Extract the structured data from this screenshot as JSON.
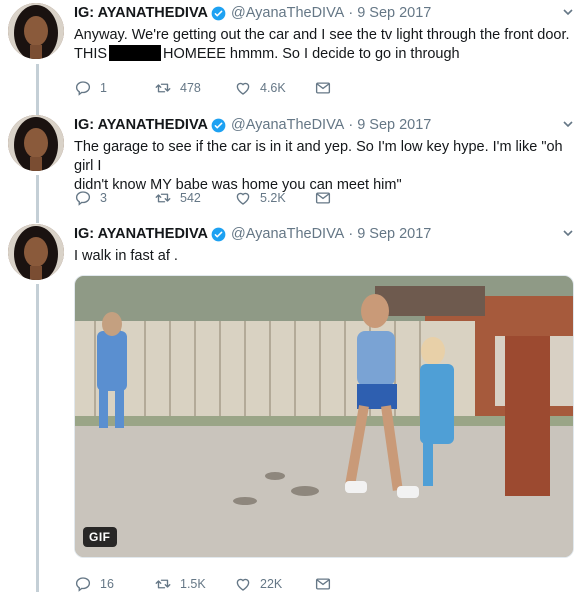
{
  "tweets": [
    {
      "name": "IG: AYANATHEDIVA",
      "handle": "@AyanaTheDIVA",
      "separator": "·",
      "date": "9 Sep 2017",
      "text_line1": "Anyway. We're getting out the car and I see the tv light through the front door.",
      "text_line2_before": "THIS",
      "text_line2_after": "HOMEEE hmmm. So I decide to go in through",
      "replies": "1",
      "retweets": "478",
      "likes": "4.6K"
    },
    {
      "name": "IG: AYANATHEDIVA",
      "handle": "@AyanaTheDIVA",
      "separator": "·",
      "date": "9 Sep 2017",
      "text_line1": "The garage to see if the car is in it and yep. So I'm low key hype. I'm like \"oh girl I",
      "text_line2": "didn't know MY babe was home you can meet him\"",
      "replies": "3",
      "retweets": "542",
      "likes": "5.2K"
    },
    {
      "name": "IG: AYANATHEDIVA",
      "handle": "@AyanaTheDIVA",
      "separator": "·",
      "date": "9 Sep 2017",
      "text_line1": "I walk in fast af .",
      "media_badge": "GIF",
      "replies": "16",
      "retweets": "1.5K",
      "likes": "22K"
    }
  ],
  "colors": {
    "verified": "#1da1f2",
    "muted": "#657786",
    "thread_line": "#c4cfd6"
  },
  "icons": [
    "reply-icon",
    "retweet-icon",
    "like-icon",
    "message-icon",
    "verified-icon",
    "chevron-down-icon"
  ]
}
